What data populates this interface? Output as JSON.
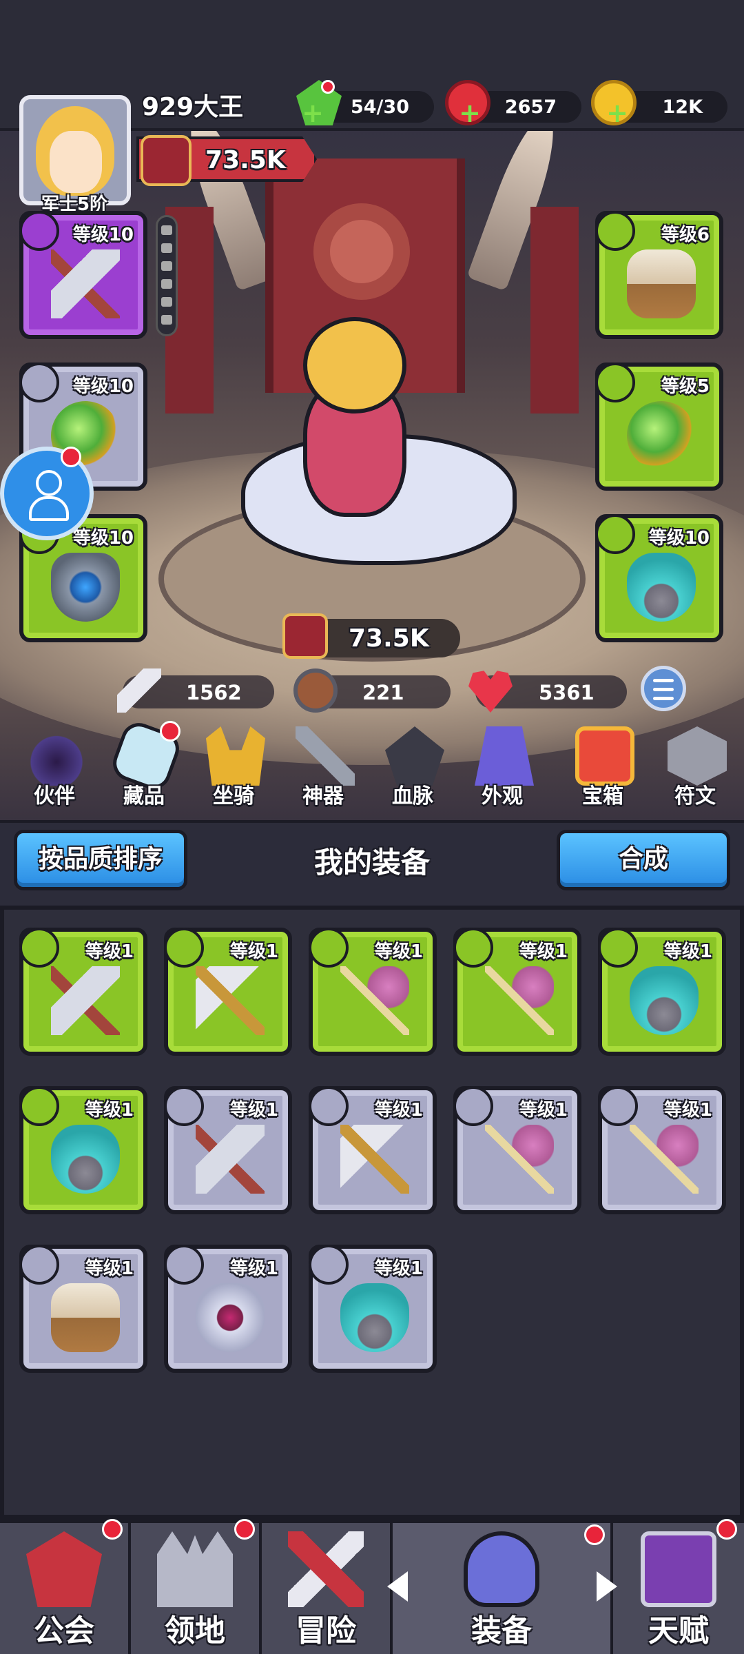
{
  "player": {
    "name": "929大王",
    "rank": "军士5阶",
    "power": "73.5K"
  },
  "resources": [
    {
      "icon": "energy-gem-icon",
      "value": "54/30"
    },
    {
      "icon": "ruby-icon",
      "value": "2657"
    },
    {
      "icon": "gold-coin-icon",
      "value": "12K"
    }
  ],
  "equipped": {
    "weapon": {
      "level": "等级10",
      "item": "axe"
    },
    "ring": {
      "level": "等级10",
      "item": "orb-ring"
    },
    "shield": {
      "level": "等级10",
      "item": "shield"
    },
    "armor": {
      "level": "等级6",
      "item": "armor"
    },
    "amulet": {
      "level": "等级5",
      "item": "orb-ring"
    },
    "mask": {
      "level": "等级10",
      "item": "mask"
    }
  },
  "hero_power": "73.5K",
  "stats": {
    "attack": "1562",
    "defense": "221",
    "health": "5361"
  },
  "menu": [
    "伙伴",
    "藏品",
    "坐骑",
    "神器",
    "血脉",
    "外观",
    "宝箱",
    "符文"
  ],
  "panel": {
    "sort_label": "按品质排序",
    "title": "我的装备",
    "merge_label": "合成"
  },
  "inventory": [
    {
      "level": "等级1",
      "item": "axe",
      "quality": "green"
    },
    {
      "level": "等级1",
      "item": "hammer",
      "quality": "green"
    },
    {
      "level": "等级1",
      "item": "bow",
      "quality": "green"
    },
    {
      "level": "等级1",
      "item": "bow",
      "quality": "green"
    },
    {
      "level": "等级1",
      "item": "mask",
      "quality": "green"
    },
    {
      "level": "等级1",
      "item": "mask",
      "quality": "green"
    },
    {
      "level": "等级1",
      "item": "axe",
      "quality": "gray"
    },
    {
      "level": "等级1",
      "item": "hammer",
      "quality": "gray"
    },
    {
      "level": "等级1",
      "item": "bow",
      "quality": "gray"
    },
    {
      "level": "等级1",
      "item": "bow",
      "quality": "gray"
    },
    {
      "level": "等级1",
      "item": "armor",
      "quality": "gray"
    },
    {
      "level": "等级1",
      "item": "pink-mask",
      "quality": "gray"
    },
    {
      "level": "等级1",
      "item": "mask",
      "quality": "gray"
    }
  ],
  "bottom_nav": [
    "公会",
    "领地",
    "冒险",
    "装备",
    "天赋"
  ],
  "colors": {
    "quality_green": "#8ac526",
    "quality_purple": "#9b3fd0",
    "quality_gray": "#a8a9c6",
    "accent_blue": "#2a8ce4",
    "notify_red": "#e8243a"
  }
}
